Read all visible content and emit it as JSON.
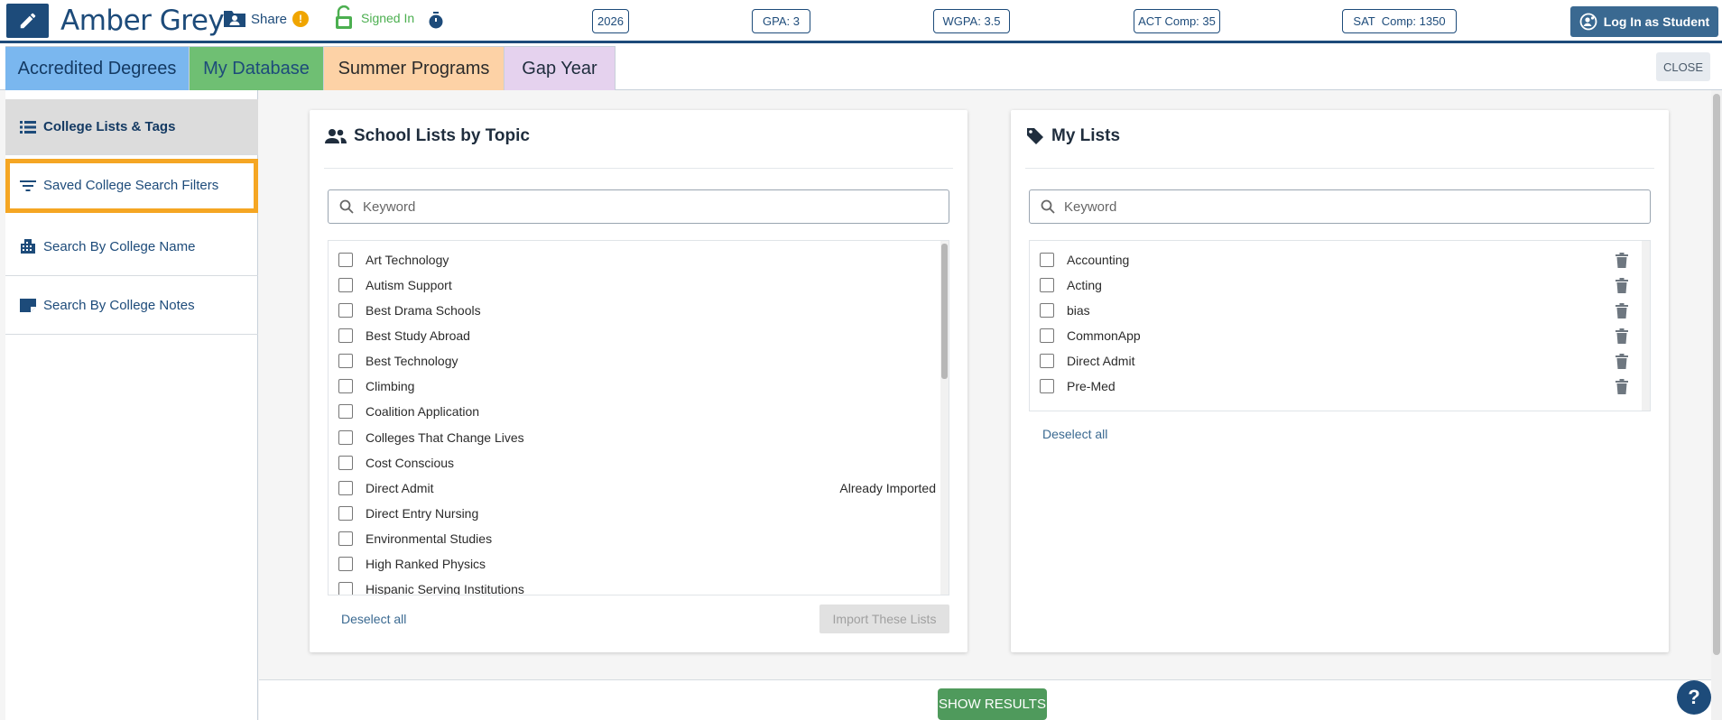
{
  "header": {
    "student_name": "Amber Grey",
    "share_label": "Share",
    "share_badge": "!",
    "signed_in_label": "Signed In",
    "stats": [
      "2026",
      "GPA: 3",
      "WGPA: 3.5",
      "ACT Comp: 35",
      "SAT  Comp: 1350"
    ],
    "login_label": "Log In as Student"
  },
  "tabs": [
    {
      "label": "Accredited Degrees"
    },
    {
      "label": "My Database"
    },
    {
      "label": "Summer Programs"
    },
    {
      "label": "Gap Year"
    }
  ],
  "close_label": "CLOSE",
  "sidebar": {
    "items": [
      {
        "label": "College Lists & Tags",
        "icon": "list-icon",
        "active": true
      },
      {
        "label": "Saved College Search Filters",
        "icon": "filter-icon",
        "highlighted": true
      },
      {
        "label": "Search By College Name",
        "icon": "building-icon"
      },
      {
        "label": "Search By College Notes",
        "icon": "note-icon"
      }
    ]
  },
  "topic_lists": {
    "title": "School Lists by Topic",
    "search_placeholder": "Keyword",
    "items": [
      {
        "label": "Art Technology",
        "note": ""
      },
      {
        "label": "Autism Support",
        "note": ""
      },
      {
        "label": "Best Drama Schools",
        "note": ""
      },
      {
        "label": "Best Study Abroad",
        "note": ""
      },
      {
        "label": "Best Technology",
        "note": ""
      },
      {
        "label": "Climbing",
        "note": ""
      },
      {
        "label": "Coalition Application",
        "note": ""
      },
      {
        "label": "Colleges That Change Lives",
        "note": ""
      },
      {
        "label": "Cost Conscious",
        "note": ""
      },
      {
        "label": "Direct Admit",
        "note": "Already Imported"
      },
      {
        "label": "Direct Entry Nursing",
        "note": ""
      },
      {
        "label": "Environmental Studies",
        "note": ""
      },
      {
        "label": "High Ranked Physics",
        "note": ""
      },
      {
        "label": "Hispanic Serving Institutions",
        "note": ""
      }
    ],
    "deselect_label": "Deselect all",
    "import_label": "Import These Lists"
  },
  "my_lists": {
    "title": "My Lists",
    "search_placeholder": "Keyword",
    "items": [
      {
        "label": "Accounting"
      },
      {
        "label": "Acting"
      },
      {
        "label": "bias"
      },
      {
        "label": "CommonApp"
      },
      {
        "label": "Direct Admit"
      },
      {
        "label": "Pre-Med"
      }
    ],
    "deselect_label": "Deselect all"
  },
  "show_results_label": "SHOW RESULTS",
  "help_label": "?",
  "colors": {
    "brand_navy": "#1d4b7a",
    "highlight_orange": "#f5a623",
    "show_results_green": "#4f9a5c",
    "tab_blue": "#7ab7ef",
    "tab_green": "#6fbf73",
    "tab_orange": "#fdd2a6",
    "tab_purple": "#e5d2ee"
  }
}
